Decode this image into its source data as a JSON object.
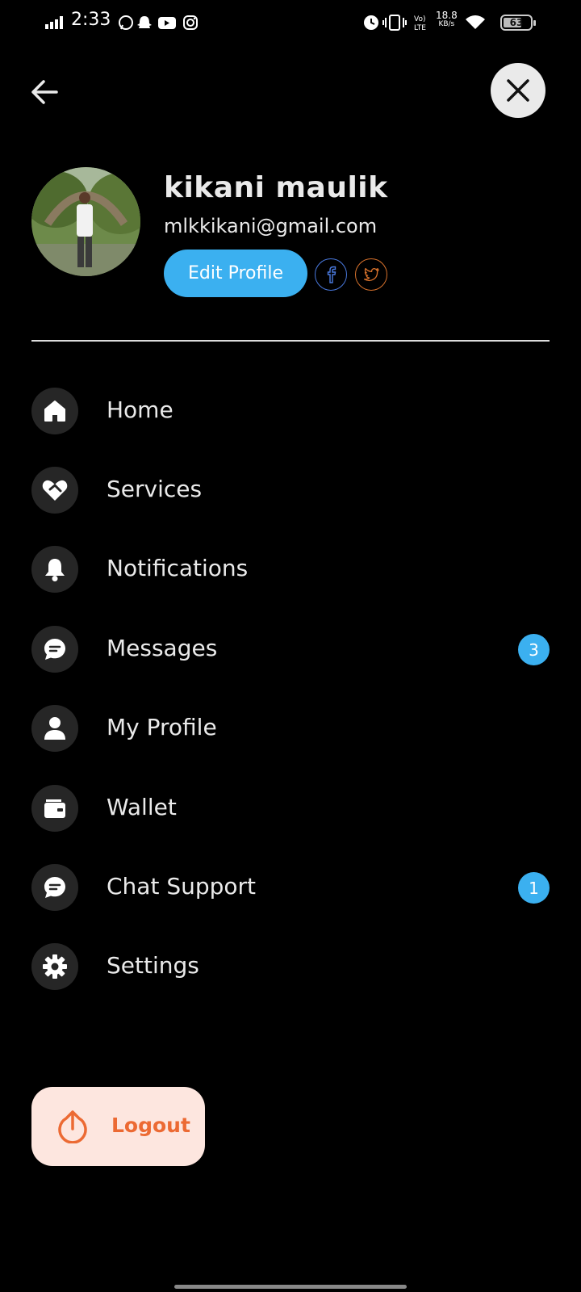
{
  "status_bar": {
    "time": "2:33",
    "net_speed_value": "18.8",
    "net_speed_unit": "KB/s",
    "network_label": "Vo) LTE",
    "battery": "63",
    "app_icons": [
      "whatsapp-icon",
      "snapchat-icon",
      "youtube-icon",
      "instagram-icon"
    ],
    "right_icons": [
      "alarm-icon",
      "vibrate-icon",
      "volte-icon",
      "wifi-icon",
      "battery-icon"
    ]
  },
  "header": {
    "back_icon": "arrow-left-icon",
    "close_icon": "close-icon"
  },
  "profile": {
    "name": "kikani maulik",
    "email": "mlkkikani@gmail.com",
    "edit_label": "Edit Profile",
    "social": [
      {
        "name": "facebook-icon",
        "color": "#4a7ae0"
      },
      {
        "name": "twitter-icon",
        "color": "#d8722c"
      }
    ]
  },
  "menu": {
    "items": [
      {
        "label": "Home",
        "icon": "home-icon"
      },
      {
        "label": "Services",
        "icon": "heart-handshake-icon"
      },
      {
        "label": "Notifications",
        "icon": "bell-icon"
      },
      {
        "label": "Messages",
        "icon": "chat-bubble-icon",
        "badge": "3"
      },
      {
        "label": "My Profile",
        "icon": "person-icon"
      },
      {
        "label": "Wallet",
        "icon": "wallet-icon"
      },
      {
        "label": "Chat Support",
        "icon": "chat-bubble-icon",
        "badge": "1"
      },
      {
        "label": "Settings",
        "icon": "gear-icon"
      }
    ]
  },
  "logout": {
    "label": "Logout",
    "icon": "power-icon"
  },
  "colors": {
    "accent": "#3bb0f0",
    "logout_bg": "#fde6df",
    "logout_text": "#ec6a33",
    "background": "#000000"
  }
}
